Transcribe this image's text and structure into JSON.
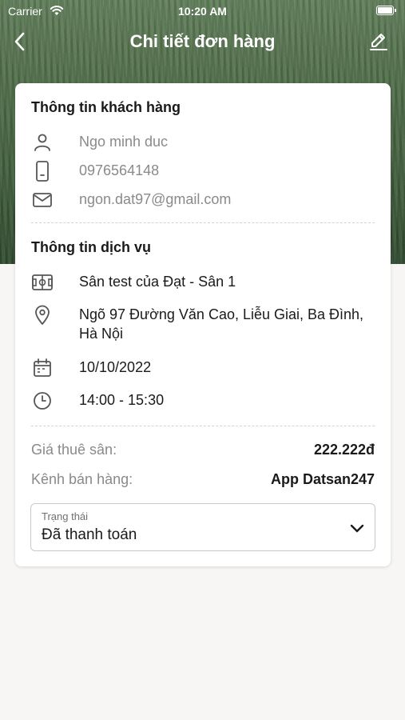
{
  "status_bar": {
    "carrier": "Carrier",
    "time": "10:20 AM"
  },
  "nav": {
    "title": "Chi tiết đơn hàng",
    "back_icon": "chevron-left-icon",
    "edit_icon": "edit-pencil-icon"
  },
  "customer": {
    "title": "Thông tin khách hàng",
    "name": "Ngo minh duc",
    "phone": "0976564148",
    "email": "ngon.dat97@gmail.com"
  },
  "service": {
    "title": "Thông tin dịch vụ",
    "field": "Sân test của Đạt - Sân 1",
    "address_line1": "Ngõ 97 Đường Văn Cao, Liễu Giai, Ba Đình,",
    "address_line2": "Hà Nội",
    "date": "10/10/2022",
    "time": "14:00 - 15:30"
  },
  "pricing": {
    "rent_label": "Giá thuê sân:",
    "rent_value": "222.222đ",
    "channel_label": "Kênh bán hàng:",
    "channel_value": "App Datsan247"
  },
  "status_select": {
    "label": "Trạng thái",
    "value": "Đã thanh toán"
  },
  "colors": {
    "background": "#f7f6f4",
    "card": "#ffffff",
    "text": "#1a1a1a",
    "muted": "#8a8a8a"
  }
}
